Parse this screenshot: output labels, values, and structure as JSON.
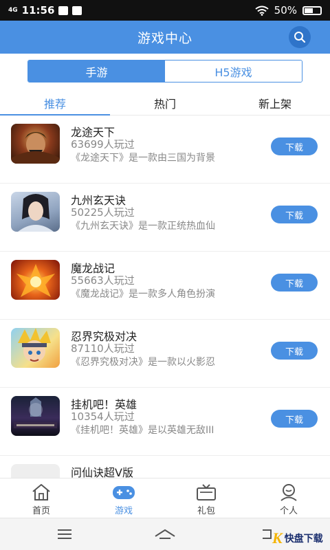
{
  "status_bar": {
    "signal": "4G",
    "time": "11:56",
    "battery": "50%"
  },
  "header": {
    "title": "游戏中心"
  },
  "segment": {
    "tabs": [
      "手游",
      "H5游戏"
    ]
  },
  "tabs": [
    "推荐",
    "热门",
    "新上架"
  ],
  "games": [
    {
      "name": "龙途天下",
      "players": "63699人玩过",
      "desc": "《龙途天下》是一款由三国为背景",
      "button": "下载"
    },
    {
      "name": "九州玄天诀",
      "players": "50225人玩过",
      "desc": "《九州玄天诀》是一款正统热血仙",
      "button": "下载"
    },
    {
      "name": "魔龙战记",
      "players": "55663人玩过",
      "desc": "《魔龙战记》是一款多人角色扮演",
      "button": "下载"
    },
    {
      "name": "忍界究极对决",
      "players": "87110人玩过",
      "desc": "《忍界究极对决》是一款以火影忍",
      "button": "下载"
    },
    {
      "name": "挂机吧！英雄",
      "players": "10354人玩过",
      "desc": "《挂机吧！英雄》是以英雄无敌III",
      "button": "下载"
    },
    {
      "name": "问仙诀超V版",
      "players": "",
      "desc": "",
      "button": ""
    }
  ],
  "bottom_nav": [
    "首页",
    "游戏",
    "礼包",
    "个人"
  ],
  "watermark": {
    "letter": "K",
    "text": "快盘下载"
  },
  "colors": {
    "accent": "#4a90e2",
    "header": "#4a90e2"
  }
}
